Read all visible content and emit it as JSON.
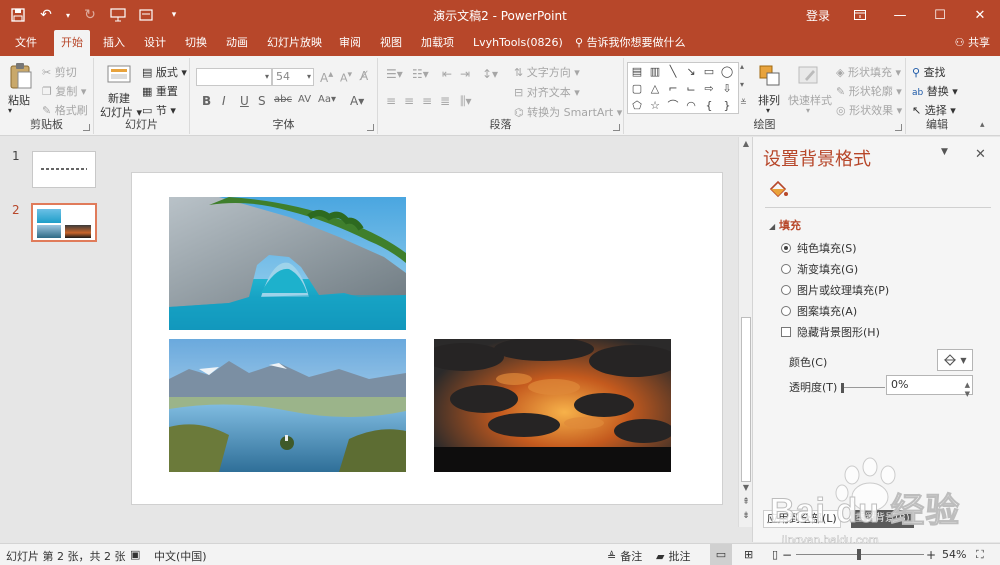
{
  "window": {
    "title": "演示文稿2 - PowerPoint",
    "login_label": "登录"
  },
  "tabs": [
    "文件",
    "开始",
    "插入",
    "设计",
    "切换",
    "动画",
    "幻灯片放映",
    "审阅",
    "视图",
    "加载项",
    "LvyhTools(0826)"
  ],
  "active_tab": "开始",
  "tell_me": "告诉我你想要做什么",
  "share_label": "共享",
  "ribbon": {
    "clipboard": {
      "label": "剪贴板",
      "paste": "粘贴",
      "cut": "剪切",
      "copy": "复制",
      "format_painter": "格式刷"
    },
    "slides": {
      "label": "幻灯片",
      "new_slide_1": "新建",
      "new_slide_2": "幻灯片",
      "layout": "版式",
      "reset": "重置",
      "section": "节"
    },
    "font": {
      "label": "字体",
      "font_size": "54"
    },
    "paragraph": {
      "label": "段落",
      "text_direction": "文字方向",
      "align_text": "对齐文本",
      "smartart": "转换为 SmartArt"
    },
    "drawing": {
      "label": "绘图",
      "arrange": "排列",
      "quick_styles": "快速样式",
      "shape_fill": "形状填充",
      "shape_outline": "形状轮廓",
      "shape_effects": "形状效果"
    },
    "editing": {
      "label": "编辑",
      "find": "查找",
      "replace": "替换",
      "select": "选择"
    }
  },
  "thumbnails": [
    {
      "number": "1",
      "active": false
    },
    {
      "number": "2",
      "active": true
    }
  ],
  "format_pane": {
    "title": "设置背景格式",
    "section": "填充",
    "options": [
      {
        "label": "纯色填充(S)",
        "selected": true
      },
      {
        "label": "渐变填充(G)",
        "selected": false
      },
      {
        "label": "图片或纹理填充(P)",
        "selected": false
      },
      {
        "label": "图案填充(A)",
        "selected": false
      }
    ],
    "hide_graphics": "隐藏背景图形(H)",
    "color_label": "颜色(C)",
    "transparency_label": "透明度(T)",
    "transparency_value": "0%",
    "transparency_level": 0,
    "apply_all": "应用到全部(L)",
    "reset_bg": "重置背景(B)"
  },
  "status": {
    "slide_info": "幻灯片 第 2 张，共 2 张",
    "language": "中文(中国)",
    "notes": "备注",
    "comments": "批注",
    "zoom": "54%",
    "zoom_level": 0.54
  },
  "watermark": {
    "brand": "Bai du 经验",
    "url": "jingyan.baidu.com"
  },
  "colors": {
    "accent": "#b7472a",
    "ribbon": "#f3f3f3",
    "workspace": "#e6e6e6"
  }
}
